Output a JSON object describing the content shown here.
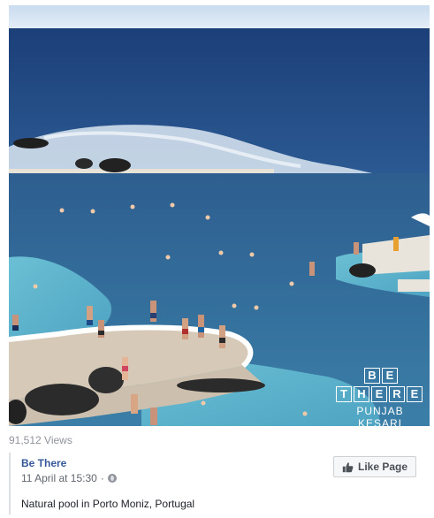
{
  "video": {
    "scene": "natural-pool-porto-moniz",
    "watermark": {
      "line1": [
        "B",
        "E"
      ],
      "line2": [
        "T",
        "H",
        "E",
        "R",
        "E"
      ],
      "sub": "PUNJAB KESARI"
    }
  },
  "stats": {
    "views": "91,512 Views"
  },
  "post": {
    "page_name": "Be There",
    "timestamp": "11 April at 15:30",
    "separator": "·",
    "privacy_icon": "globe-icon",
    "caption": "Natural pool in Porto Moniz, Portugal"
  },
  "actions": {
    "like_page_label": "Like Page",
    "like_icon": "thumbs-up-icon"
  },
  "colors": {
    "link": "#365899",
    "muted": "#90949c",
    "button_bg": "#f6f7f9"
  }
}
